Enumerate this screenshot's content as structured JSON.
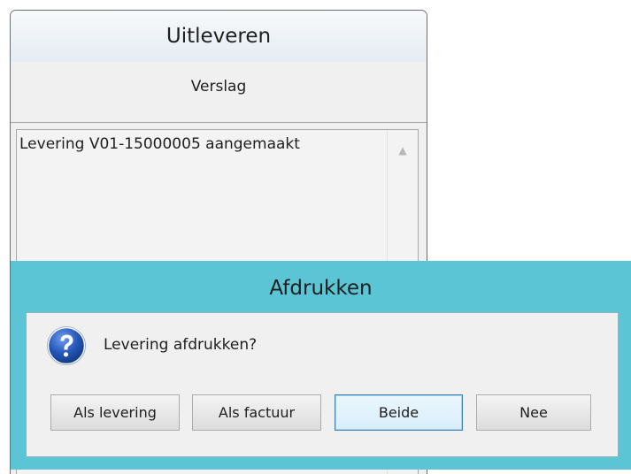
{
  "background_window": {
    "title": "Uitleveren",
    "section_label": "Verslag",
    "report_lines": [
      "Levering V01-15000005 aangemaakt"
    ]
  },
  "dialog": {
    "title": "Afdrukken",
    "message": "Levering afdrukken?",
    "icon": "question-icon",
    "buttons": {
      "as_delivery": "Als levering",
      "as_invoice": "Als factuur",
      "both": "Beide",
      "no": "Nee"
    },
    "default_button": "both"
  },
  "colors": {
    "dialog_frame": "#5bc5d6",
    "dialog_body": "#f0f0f0",
    "window_background": "#f0f0f0",
    "default_button_border": "#3c7fb1",
    "question_icon_blue": "#1f4fa8"
  }
}
